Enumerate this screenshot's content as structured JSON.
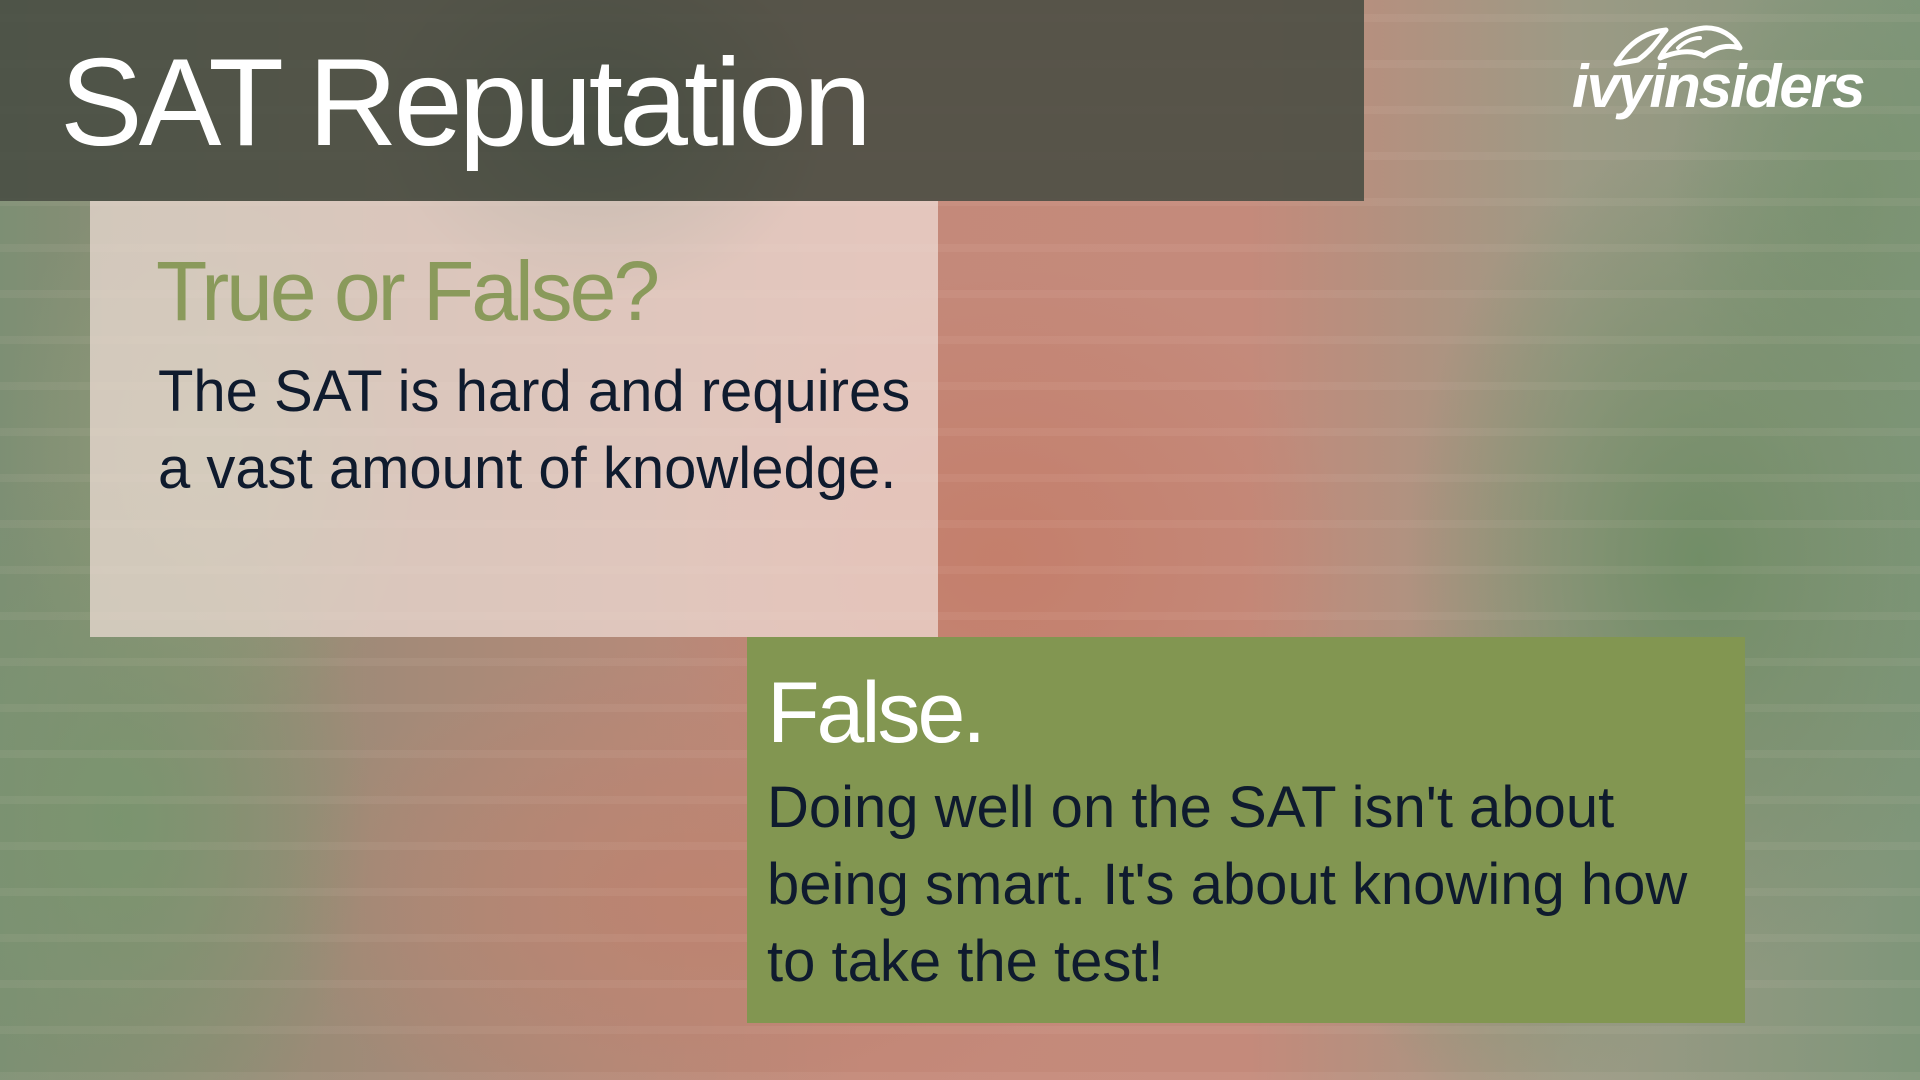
{
  "slide": {
    "title": "SAT Reputation",
    "logo_text": "ivyinsiders",
    "question": {
      "heading": "True or False?",
      "body": "The SAT is hard and requires a vast amount of knowledge."
    },
    "answer": {
      "heading": "False.",
      "body": "Doing well on the SAT isn't about being smart. It's about knowing how to take the test!"
    }
  },
  "colors": {
    "title_bar": "#484C42",
    "question_box": "#F0DED7",
    "question_heading": "#8A9A5B",
    "answer_box": "#829651",
    "body_text": "#0F1B2E",
    "title_text": "#FFFFFF"
  },
  "icons": {
    "logo_mark": "ivy-leaf-icon"
  }
}
